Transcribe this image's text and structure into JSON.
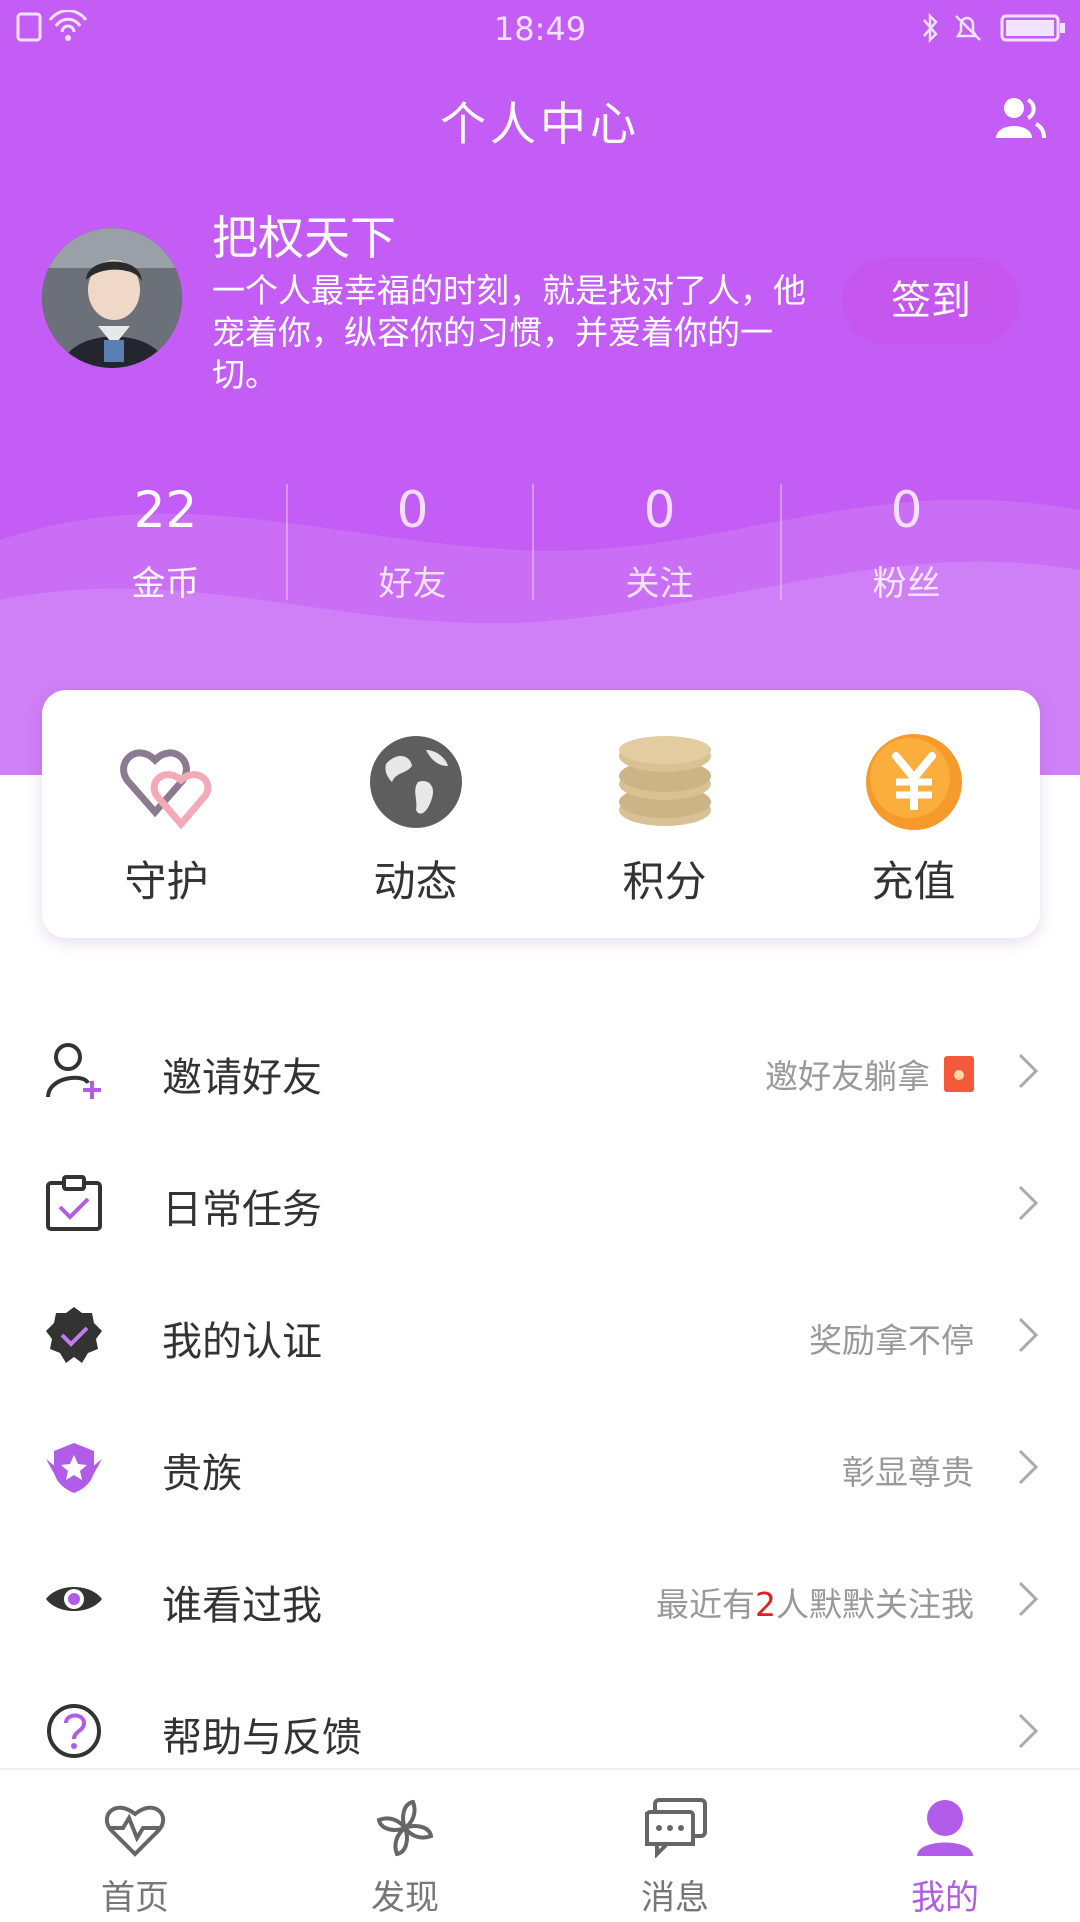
{
  "status_bar": {
    "time": "18:49"
  },
  "header": {
    "title": "个人中心"
  },
  "profile": {
    "username": "把权天下",
    "bio": "一个人最幸福的时刻，就是找对了人，他宠着你，纵容你的习惯，并爱着你的一切。",
    "signin_label": "签到"
  },
  "stats": [
    {
      "value": "22",
      "label": "金币"
    },
    {
      "value": "0",
      "label": "好友"
    },
    {
      "value": "0",
      "label": "关注"
    },
    {
      "value": "0",
      "label": "粉丝"
    }
  ],
  "quick_actions": [
    {
      "label": "守护",
      "icon": "hearts-icon"
    },
    {
      "label": "动态",
      "icon": "globe-icon"
    },
    {
      "label": "积分",
      "icon": "coins-icon"
    },
    {
      "label": "充值",
      "icon": "yuan-icon"
    }
  ],
  "menu": [
    {
      "label": "邀请好友",
      "sub": "邀好友躺拿",
      "icon": "add-user-icon"
    },
    {
      "label": "日常任务",
      "sub": "",
      "icon": "clipboard-check-icon"
    },
    {
      "label": "我的认证",
      "sub": "奖励拿不停",
      "icon": "verified-badge-icon"
    },
    {
      "label": "贵族",
      "sub": "彰显尊贵",
      "icon": "noble-badge-icon"
    },
    {
      "label": "谁看过我",
      "sub_prefix": "最近有",
      "sub_count": "2",
      "sub_suffix": "人默默关注我",
      "icon": "eye-icon"
    },
    {
      "label": "帮助与反馈",
      "sub": "",
      "icon": "help-icon"
    }
  ],
  "tabs": [
    {
      "label": "首页",
      "icon": "heartbeat-icon"
    },
    {
      "label": "发现",
      "icon": "pinwheel-icon"
    },
    {
      "label": "消息",
      "icon": "chat-icon"
    },
    {
      "label": "我的",
      "icon": "person-icon"
    }
  ],
  "colors": {
    "primary": "#c35df5",
    "accent": "#b05ce8",
    "highlight": "#e02020"
  }
}
